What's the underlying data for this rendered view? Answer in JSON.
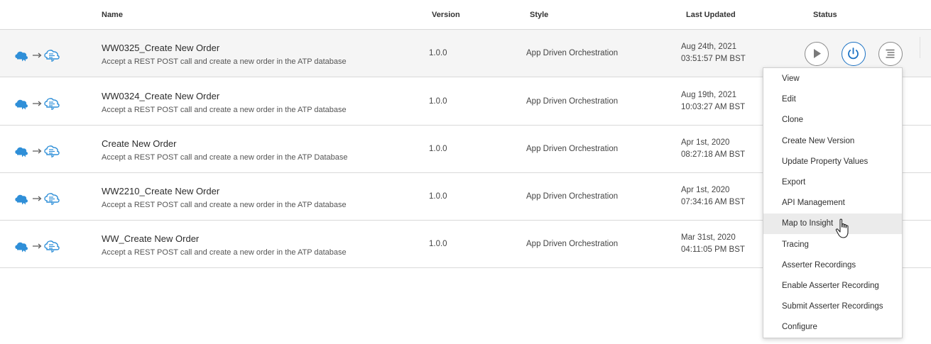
{
  "table": {
    "columns": {
      "name": "Name",
      "version": "Version",
      "style": "Style",
      "last_updated": "Last Updated",
      "status": "Status"
    },
    "rows": [
      {
        "name": "WW0325_Create New Order",
        "description": "Accept a REST POST call and create a new order in the ATP database",
        "version": "1.0.0",
        "style": "App Driven Orchestration",
        "date": "Aug 24th, 2021",
        "time": "03:51:57 PM BST"
      },
      {
        "name": "WW0324_Create New Order",
        "description": "Accept a REST POST call and create a new order in the ATP database",
        "version": "1.0.0",
        "style": "App Driven Orchestration",
        "date": "Aug 19th, 2021",
        "time": "10:03:27 AM BST"
      },
      {
        "name": "Create New Order",
        "description": "Accept a REST POST call and create a new order in the ATP Database",
        "version": "1.0.0",
        "style": "App Driven Orchestration",
        "date": "Apr 1st, 2020",
        "time": "08:27:18 AM BST"
      },
      {
        "name": "WW2210_Create New Order",
        "description": "Accept a REST POST call and create a new order in the ATP database",
        "version": "1.0.0",
        "style": "App Driven Orchestration",
        "date": "Apr 1st, 2020",
        "time": "07:34:16 AM BST"
      },
      {
        "name": "WW_Create New Order",
        "description": "Accept a REST POST call and create a new order in the ATP database",
        "version": "1.0.0",
        "style": "App Driven Orchestration",
        "date": "Mar 31st, 2020",
        "time": "04:11:05 PM BST"
      }
    ]
  },
  "status_actions": {
    "icons": [
      "run-icon",
      "power-icon",
      "hamburger-menu-icon"
    ],
    "activate_color": "#1b72c4"
  },
  "row_icon": {
    "icons": [
      "cloud-icon",
      "arrow-right-icon",
      "cloud-integration-icon"
    ],
    "color": "#2f8fd8"
  },
  "actions_menu": {
    "items": [
      "View",
      "Edit",
      "Clone",
      "Create New Version",
      "Update Property Values",
      "Export",
      "API Management",
      "Map to Insight",
      "Tracing",
      "Asserter Recordings",
      "Enable Asserter Recording",
      "Submit Asserter Recordings",
      "Configure"
    ],
    "hovered_item": "Map to Insight"
  },
  "colors": {
    "active_row_bg": "#f5f5f5",
    "divider": "#d9d9d9",
    "menu_hover": "#ebebeb"
  }
}
